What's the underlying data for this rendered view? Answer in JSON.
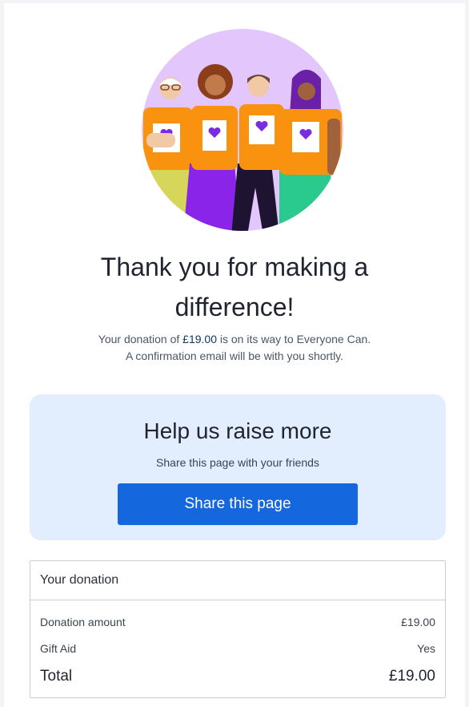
{
  "hero": {
    "image": "illustration of four volunteers in orange heart t-shirts hugging"
  },
  "heading": {
    "line1": "Thank you for making a",
    "line2": "difference!"
  },
  "message": {
    "prefix": "Your donation of ",
    "amount": "£19.00",
    "suffix": " is on its way to Everyone Can.",
    "line2": "A confirmation email will be with you shortly."
  },
  "share": {
    "title": "Help us raise more",
    "subtitle": "Share this page with your friends",
    "button_label": "Share this page"
  },
  "summary": {
    "title": "Your donation",
    "rows": [
      {
        "label": "Donation amount",
        "value": "£19.00"
      },
      {
        "label": "Gift Aid",
        "value": "Yes"
      }
    ],
    "total": {
      "label": "Total",
      "value": "£19.00"
    }
  },
  "colors": {
    "accent": "#1467dc",
    "share_background": "#e2eefd",
    "hero_background": "#e3c6fb",
    "shirt": "#f8920f",
    "heart": "#7b2be0"
  }
}
